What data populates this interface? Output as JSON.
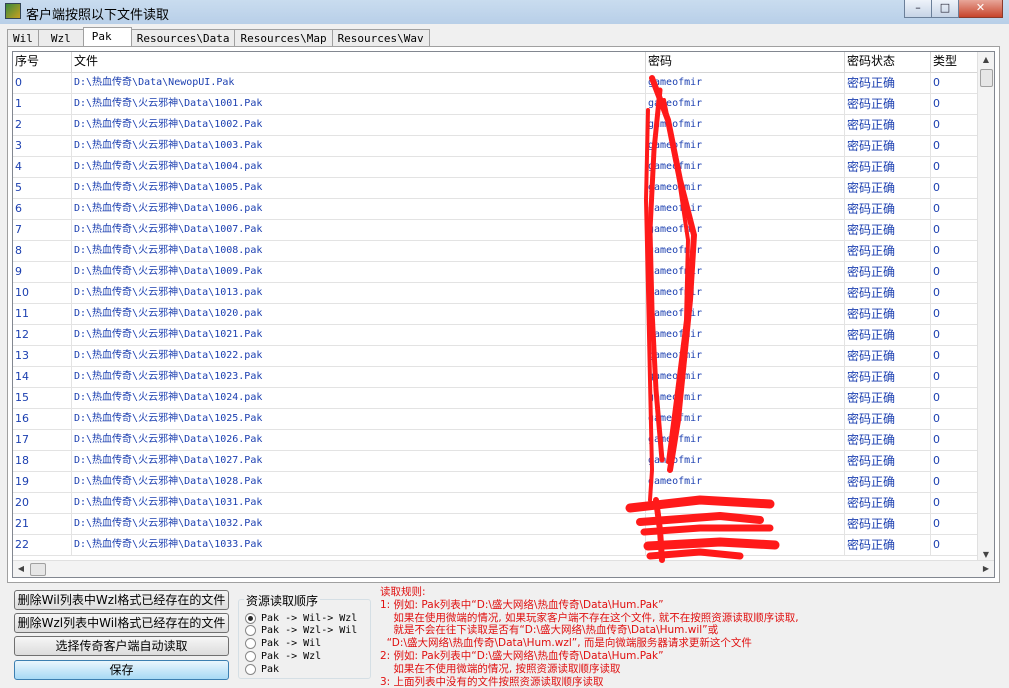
{
  "window": {
    "title": "客户端按照以下文件读取",
    "controls": [
      "–",
      "□",
      "✕"
    ]
  },
  "tabs": [
    "Wil",
    "Wzl",
    "Pak",
    "Resources\\Data",
    "Resources\\Map",
    "Resources\\Wav"
  ],
  "active_tab": "Pak",
  "table": {
    "columns": [
      "序号",
      "文件",
      "密码",
      "密码状态",
      "类型"
    ],
    "rows": [
      {
        "idx": "0",
        "file": "D:\\热血传奇\\Data\\NewopUI.Pak",
        "pwd": "gameofmir",
        "status": "密码正确",
        "type": "0"
      },
      {
        "idx": "1",
        "file": "D:\\热血传奇\\火云邪神\\Data\\1001.Pak",
        "pwd": "gameofmir",
        "status": "密码正确",
        "type": "0"
      },
      {
        "idx": "2",
        "file": "D:\\热血传奇\\火云邪神\\Data\\1002.Pak",
        "pwd": "gameofmir",
        "status": "密码正确",
        "type": "0"
      },
      {
        "idx": "3",
        "file": "D:\\热血传奇\\火云邪神\\Data\\1003.Pak",
        "pwd": "gameofmir",
        "status": "密码正确",
        "type": "0"
      },
      {
        "idx": "4",
        "file": "D:\\热血传奇\\火云邪神\\Data\\1004.pak",
        "pwd": "gameofmir",
        "status": "密码正确",
        "type": "0"
      },
      {
        "idx": "5",
        "file": "D:\\热血传奇\\火云邪神\\Data\\1005.Pak",
        "pwd": "gameofmir",
        "status": "密码正确",
        "type": "0"
      },
      {
        "idx": "6",
        "file": "D:\\热血传奇\\火云邪神\\Data\\1006.pak",
        "pwd": "gameofmir",
        "status": "密码正确",
        "type": "0"
      },
      {
        "idx": "7",
        "file": "D:\\热血传奇\\火云邪神\\Data\\1007.Pak",
        "pwd": "gameofmir",
        "status": "密码正确",
        "type": "0"
      },
      {
        "idx": "8",
        "file": "D:\\热血传奇\\火云邪神\\Data\\1008.pak",
        "pwd": "gameofmir",
        "status": "密码正确",
        "type": "0"
      },
      {
        "idx": "9",
        "file": "D:\\热血传奇\\火云邪神\\Data\\1009.Pak",
        "pwd": "gameofmir",
        "status": "密码正确",
        "type": "0"
      },
      {
        "idx": "10",
        "file": "D:\\热血传奇\\火云邪神\\Data\\1013.pak",
        "pwd": "gameofmir",
        "status": "密码正确",
        "type": "0"
      },
      {
        "idx": "11",
        "file": "D:\\热血传奇\\火云邪神\\Data\\1020.pak",
        "pwd": "gameofmir",
        "status": "密码正确",
        "type": "0"
      },
      {
        "idx": "12",
        "file": "D:\\热血传奇\\火云邪神\\Data\\1021.Pak",
        "pwd": "gameofmir",
        "status": "密码正确",
        "type": "0"
      },
      {
        "idx": "13",
        "file": "D:\\热血传奇\\火云邪神\\Data\\1022.pak",
        "pwd": "gameofmir",
        "status": "密码正确",
        "type": "0"
      },
      {
        "idx": "14",
        "file": "D:\\热血传奇\\火云邪神\\Data\\1023.Pak",
        "pwd": "gameofmir",
        "status": "密码正确",
        "type": "0"
      },
      {
        "idx": "15",
        "file": "D:\\热血传奇\\火云邪神\\Data\\1024.pak",
        "pwd": "gameofmir",
        "status": "密码正确",
        "type": "0"
      },
      {
        "idx": "16",
        "file": "D:\\热血传奇\\火云邪神\\Data\\1025.Pak",
        "pwd": "gameofmir",
        "status": "密码正确",
        "type": "0"
      },
      {
        "idx": "17",
        "file": "D:\\热血传奇\\火云邪神\\Data\\1026.Pak",
        "pwd": "gameofmir",
        "status": "密码正确",
        "type": "0"
      },
      {
        "idx": "18",
        "file": "D:\\热血传奇\\火云邪神\\Data\\1027.Pak",
        "pwd": "gameofmir",
        "status": "密码正确",
        "type": "0"
      },
      {
        "idx": "19",
        "file": "D:\\热血传奇\\火云邪神\\Data\\1028.Pak",
        "pwd": "gameofmir",
        "status": "密码正确",
        "type": "0"
      },
      {
        "idx": "20",
        "file": "D:\\热血传奇\\火云邪神\\Data\\1031.Pak",
        "pwd": "",
        "status": "密码正确",
        "type": "0"
      },
      {
        "idx": "21",
        "file": "D:\\热血传奇\\火云邪神\\Data\\1032.Pak",
        "pwd": "",
        "status": "密码正确",
        "type": "0"
      },
      {
        "idx": "22",
        "file": "D:\\热血传奇\\火云邪神\\Data\\1033.Pak",
        "pwd": "",
        "status": "密码正确",
        "type": "0"
      }
    ]
  },
  "icons": {
    "scroll_up": "▲",
    "scroll_down": "▼",
    "scroll_left": "◀",
    "scroll_right": "▶"
  },
  "buttons": {
    "delete_wil": "删除Wil列表中Wzl格式已经存在的文件",
    "delete_wzl": "删除Wzl列表中Wil格式已经存在的文件",
    "select_client": "选择传奇客户端自动读取",
    "save": "保存"
  },
  "read_order": {
    "title": "资源读取顺序",
    "options": [
      "Pak -> Wil-> Wzl",
      "Pak -> Wzl-> Wil",
      "Pak -> Wil",
      "Pak -> Wzl",
      "Pak"
    ],
    "selected_index": 0
  },
  "rules": {
    "lines": [
      "读取规则:",
      "1: 例如: Pak列表中“D:\\盛大网络\\热血传奇\\Data\\Hum.Pak”",
      "    如果在使用微端的情况, 如果玩家客户端不存在这个文件, 就不在按照资源读取顺序读取,",
      "    就是不会在往下读取是否有“D:\\盛大网络\\热血传奇\\Data\\Hum.wil”或",
      "  “D:\\盛大网络\\热血传奇\\Data\\Hum.wzl”, 而是向微端服务器请求更新这个文件",
      "2: 例如: Pak列表中“D:\\盛大网络\\热血传奇\\Data\\Hum.Pak”",
      "    如果在不使用微端的情况, 按照资源读取顺序读取",
      "3: 上面列表中没有的文件按照资源读取顺序读取"
    ]
  },
  "colors": {
    "cell_text": "#1b3fb0",
    "rules_text": "#e01010",
    "scribble": "#ff1a1a"
  }
}
